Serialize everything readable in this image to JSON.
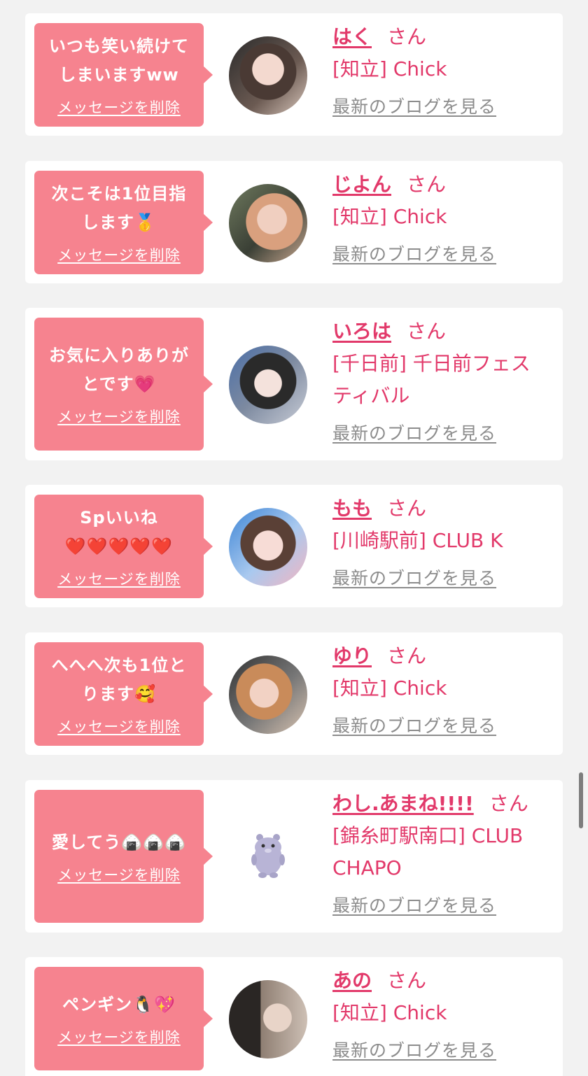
{
  "entries": [
    {
      "message_lines": [
        "いつも笑い続けて",
        "しまいますww"
      ],
      "delete_label": "メッセージを削除",
      "avatar_icon": "girl-photo-avatar",
      "name": "はく",
      "honorific": "さん",
      "shop_lines": [
        "[知立] Chick"
      ],
      "blog_label": "最新のブログを見る"
    },
    {
      "message_lines": [
        "次こそは1位目指",
        "します🥇"
      ],
      "delete_label": "メッセージを削除",
      "avatar_icon": "girl-photo-avatar",
      "name": "じよん",
      "honorific": "さん",
      "shop_lines": [
        "[知立] Chick"
      ],
      "blog_label": "最新のブログを見る"
    },
    {
      "message_lines": [
        "お気に入りありが",
        "とです💗"
      ],
      "delete_label": "メッセージを削除",
      "avatar_icon": "girl-photo-avatar",
      "name": "いろは",
      "honorific": "さん",
      "shop_lines": [
        "[千日前] 千日前フェス",
        "ティバル"
      ],
      "blog_label": "最新のブログを見る"
    },
    {
      "message_lines": [
        "Spいいね",
        "❤️❤️❤️❤️❤️"
      ],
      "delete_label": "メッセージを削除",
      "avatar_icon": "girl-photo-avatar",
      "name": "もも",
      "honorific": "さん",
      "shop_lines": [
        "[川崎駅前] CLUB K"
      ],
      "blog_label": "最新のブログを見る"
    },
    {
      "message_lines": [
        "へへへ次も1位と",
        "ります🥰"
      ],
      "delete_label": "メッセージを削除",
      "avatar_icon": "girl-photo-avatar",
      "name": "ゆり",
      "honorific": "さん",
      "shop_lines": [
        "[知立] Chick"
      ],
      "blog_label": "最新のブログを見る"
    },
    {
      "message_lines": [
        "愛してう🍙🍙🍙"
      ],
      "delete_label": "メッセージを削除",
      "avatar_icon": "default-monster-avatar",
      "name": "わし.あまね!!!!",
      "honorific": "さん",
      "shop_lines": [
        "[錦糸町駅南口] CLUB",
        "CHAPO"
      ],
      "blog_label": "最新のブログを見る"
    },
    {
      "message_lines": [
        "ペンギン🐧💖"
      ],
      "delete_label": "メッセージを削除",
      "avatar_icon": "girl-photo-avatar",
      "name": "あの",
      "honorific": "さん",
      "shop_lines": [
        "[知立] Chick"
      ],
      "blog_label": "最新のブログを見る"
    }
  ],
  "colors": {
    "background": "#f2f2f2",
    "bubble": "#f6838f",
    "accent": "#e2396a",
    "link_gray": "#8c8c8c"
  }
}
